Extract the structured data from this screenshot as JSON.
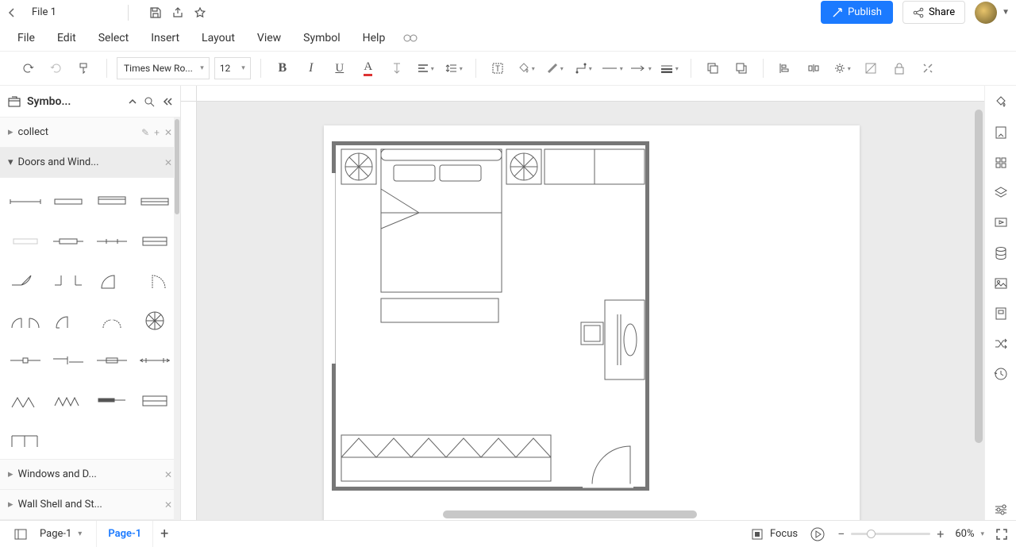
{
  "titlebar": {
    "filename": "File 1"
  },
  "actions": {
    "publish": "Publish",
    "share": "Share"
  },
  "menus": [
    "File",
    "Edit",
    "Select",
    "Insert",
    "Layout",
    "View",
    "Symbol",
    "Help"
  ],
  "toolbar": {
    "font": "Times New Ro...",
    "size": "12"
  },
  "left_panel": {
    "title": "Symbo...",
    "sections": [
      {
        "name": "collect",
        "expanded": false
      },
      {
        "name": "Doors and Wind...",
        "expanded": true
      },
      {
        "name": "Windows and D...",
        "expanded": false
      },
      {
        "name": "Wall Shell and St...",
        "expanded": false
      }
    ]
  },
  "pages": {
    "current": "Page-1",
    "active_tab": "Page-1"
  },
  "status": {
    "focus": "Focus",
    "zoom": "60%"
  }
}
